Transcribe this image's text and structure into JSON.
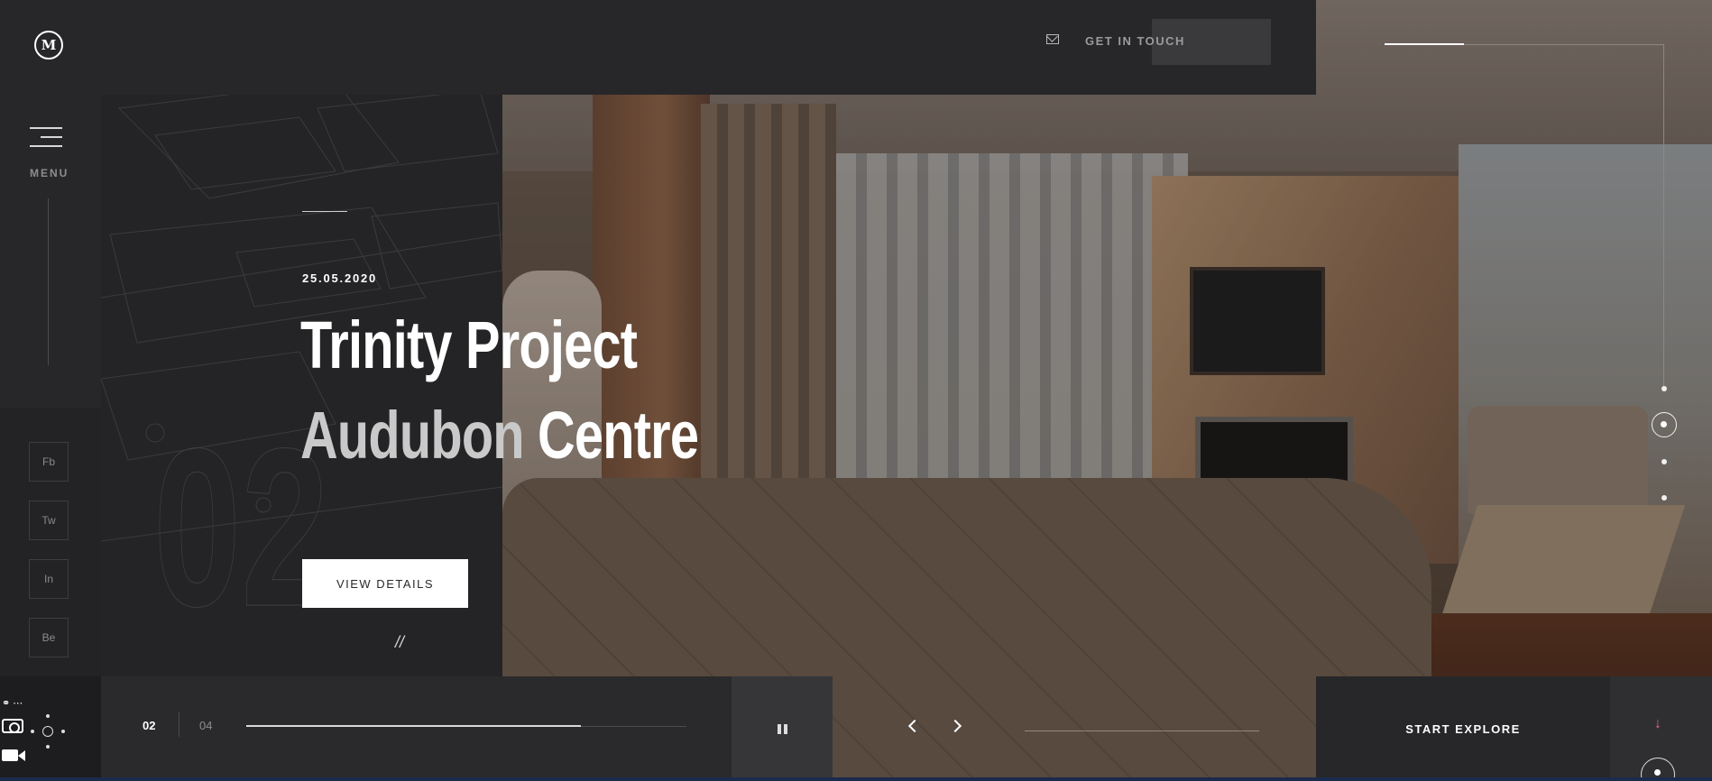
{
  "brand": {
    "logo_letter": "M"
  },
  "header": {
    "contact_label": "GET IN TOUCH"
  },
  "sidebar": {
    "menu_label": "MENU",
    "social": [
      "Fb",
      "Tw",
      "In",
      "Be"
    ]
  },
  "hero": {
    "date": "25.05.2020",
    "title_line1": "Trinity Project",
    "title_line2_dim": "Audubon",
    "title_line2_bright": "Centre",
    "slide_watermark": "02",
    "cta_label": "VIEW DETAILS",
    "divider_glyph": "//"
  },
  "slider": {
    "current": "02",
    "total": "04",
    "progress": 0.76
  },
  "explore": {
    "label": "START EXPLORE",
    "arrow": "↓"
  },
  "colors": {
    "accent_arrow": "#e06a80",
    "panel": "#272729"
  }
}
